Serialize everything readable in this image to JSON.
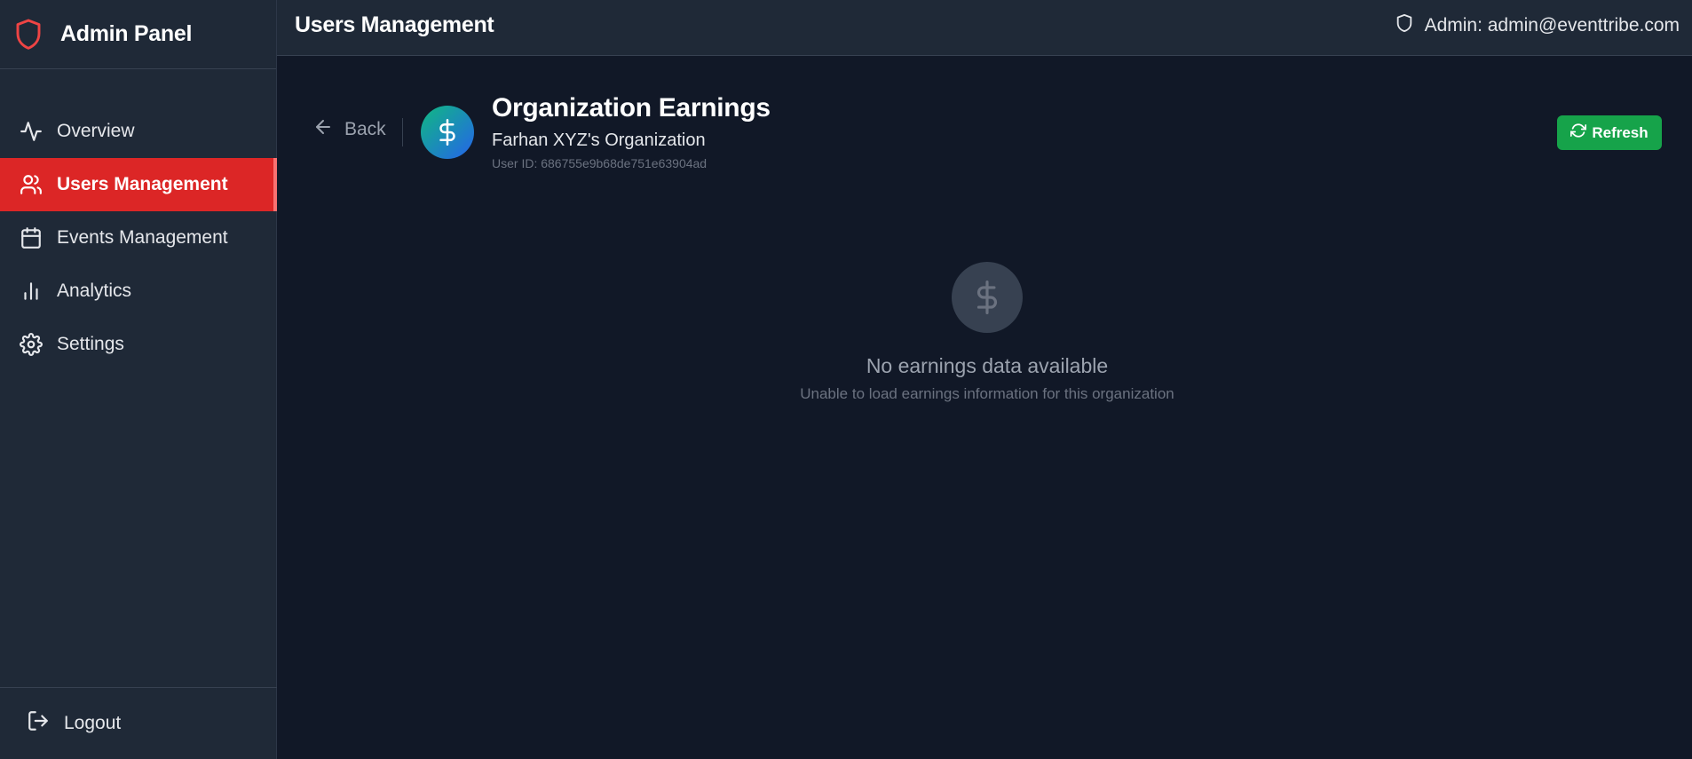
{
  "sidebar": {
    "brand_title": "Admin Panel",
    "items": [
      {
        "label": "Overview",
        "icon": "activity-icon"
      },
      {
        "label": "Users Management",
        "icon": "users-icon",
        "active": true
      },
      {
        "label": "Events Management",
        "icon": "calendar-icon"
      },
      {
        "label": "Analytics",
        "icon": "bar-chart-icon"
      },
      {
        "label": "Settings",
        "icon": "gear-icon"
      }
    ],
    "logout_label": "Logout"
  },
  "header": {
    "title": "Users Management",
    "admin_label": "Admin: admin@eventtribe.com"
  },
  "page": {
    "back_label": "Back",
    "title": "Organization Earnings",
    "org_name": "Farhan XYZ's Organization",
    "user_id": "User ID: 686755e9b68de751e63904ad",
    "refresh_label": "Refresh",
    "empty_title": "No earnings data available",
    "empty_subtitle": "Unable to load earnings information for this organization"
  },
  "colors": {
    "accent_red": "#dc2626",
    "success_green": "#16a34a",
    "background": "#111827",
    "panel": "#1f2937"
  }
}
